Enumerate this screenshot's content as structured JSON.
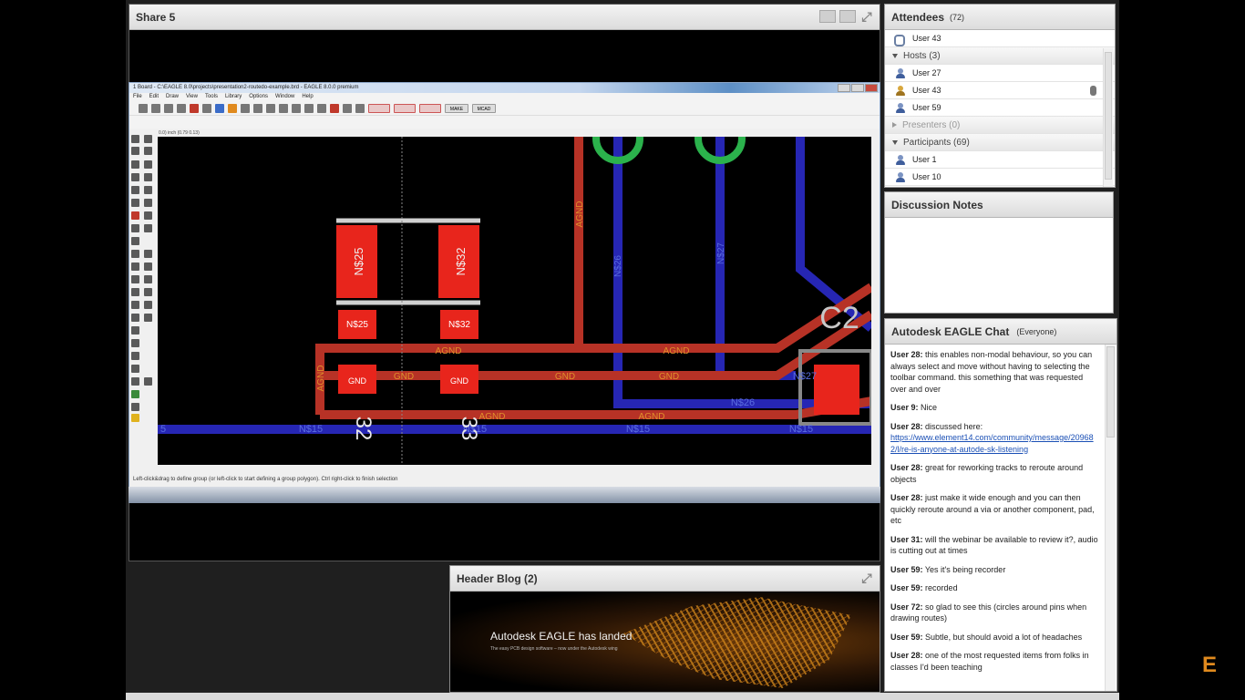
{
  "share": {
    "title": "Share 5"
  },
  "eagle": {
    "window_title": "1 Board - C:\\EAGLE 8.0\\projects\\presentation2-routedo-example.brd - EAGLE 8.0.0 premium",
    "menu": [
      "File",
      "Edit",
      "Draw",
      "View",
      "Tools",
      "Library",
      "Options",
      "Window",
      "Help"
    ],
    "coord_readout": "0.0) inch (0.79 0.13)",
    "status": "Left-click&drag to define group (or left-click to start defining a group polygon). Ctrl right-click to finish selection",
    "toolbar_labels": {
      "make": "MAKE",
      "mcad": "MCAD"
    },
    "board_labels": {
      "pad_n25": "N$25",
      "pad_n32": "N$32",
      "gnd": "GND",
      "agnd": "AGND",
      "n26": "N$26",
      "n27": "N$27",
      "n15": "N$15",
      "c2": "C2",
      "num32": "32",
      "num33": "33",
      "num5": "5"
    }
  },
  "attendees": {
    "title": "Attendees",
    "count": "(72)",
    "presenter_user": "User 43",
    "groups": {
      "hosts": {
        "label": "Hosts (3)",
        "users": [
          "User 27",
          "User 43",
          "User 59"
        ]
      },
      "presenters": {
        "label": "Presenters (0)"
      },
      "participants": {
        "label": "Participants (69)",
        "users": [
          "User 1",
          "User 10"
        ]
      }
    }
  },
  "notes": {
    "title": "Discussion Notes"
  },
  "chat": {
    "title": "Autodesk EAGLE Chat",
    "scope": "(Everyone)",
    "messages": [
      {
        "user": "User 28:",
        "text": "this enables non-modal behaviour, so you can always select and move without having to selecting the toolbar command. this something that was requested over and over"
      },
      {
        "user": "User 9:",
        "text": "Nice"
      },
      {
        "user": "User 28:",
        "text": "discussed here:",
        "link": "https://www.element14.com/community/message/209682/l/re-is-anyone-at-autode-sk-listening"
      },
      {
        "user": "User 28:",
        "text": "great for reworking tracks to reroute around objects"
      },
      {
        "user": "User 28:",
        "text": "just make it wide enough and you can then quickly reroute around a via or another component, pad, etc"
      },
      {
        "user": "User 31:",
        "text": "will the webinar be available to review it?, audio is cutting out at times"
      },
      {
        "user": "User 59:",
        "text": "Yes it's being recorder"
      },
      {
        "user": "User 59:",
        "text": "recorded"
      },
      {
        "user": "User 72:",
        "text": "so glad to see this (circles around pins when drawing routes)"
      },
      {
        "user": "User 59:",
        "text": "Subtle, but should avoid a lot of headaches"
      },
      {
        "user": "User 28:",
        "text": "one of the most requested items from folks in classes I'd been teaching"
      }
    ]
  },
  "blog": {
    "title": "Header Blog (2)",
    "banner_title": "Autodesk EAGLE has landed",
    "banner_sub": "The easy PCB design software – now under the Autodesk wing"
  },
  "brand": {
    "corner_logo": "E"
  },
  "colors": {
    "trace_red": "#c0392b",
    "trace_blue": "#2a2ab8",
    "pad_red": "#e8251c",
    "label_orange": "#e0902a",
    "via_green": "#2bb24c"
  }
}
